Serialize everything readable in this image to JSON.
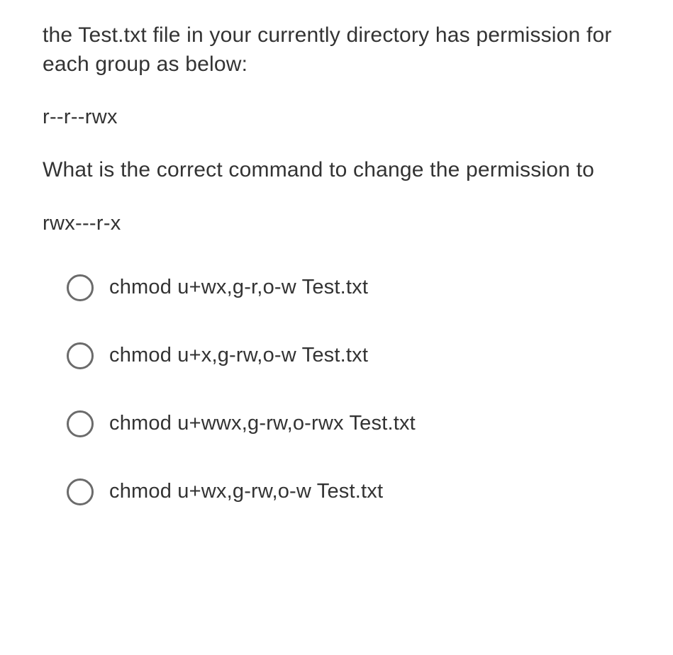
{
  "question": {
    "part1": "the Test.txt file in your currently directory has permission for each group as below:",
    "perm_before": "r--r--rwx",
    "part2": "What is the correct command to change the permission to",
    "perm_after": "rwx---r-x"
  },
  "options": [
    {
      "label": "chmod u+wx,g-r,o-w Test.txt"
    },
    {
      "label": "chmod u+x,g-rw,o-w Test.txt"
    },
    {
      "label": "chmod u+wwx,g-rw,o-rwx Test.txt"
    },
    {
      "label": "chmod u+wx,g-rw,o-w Test.txt"
    }
  ]
}
